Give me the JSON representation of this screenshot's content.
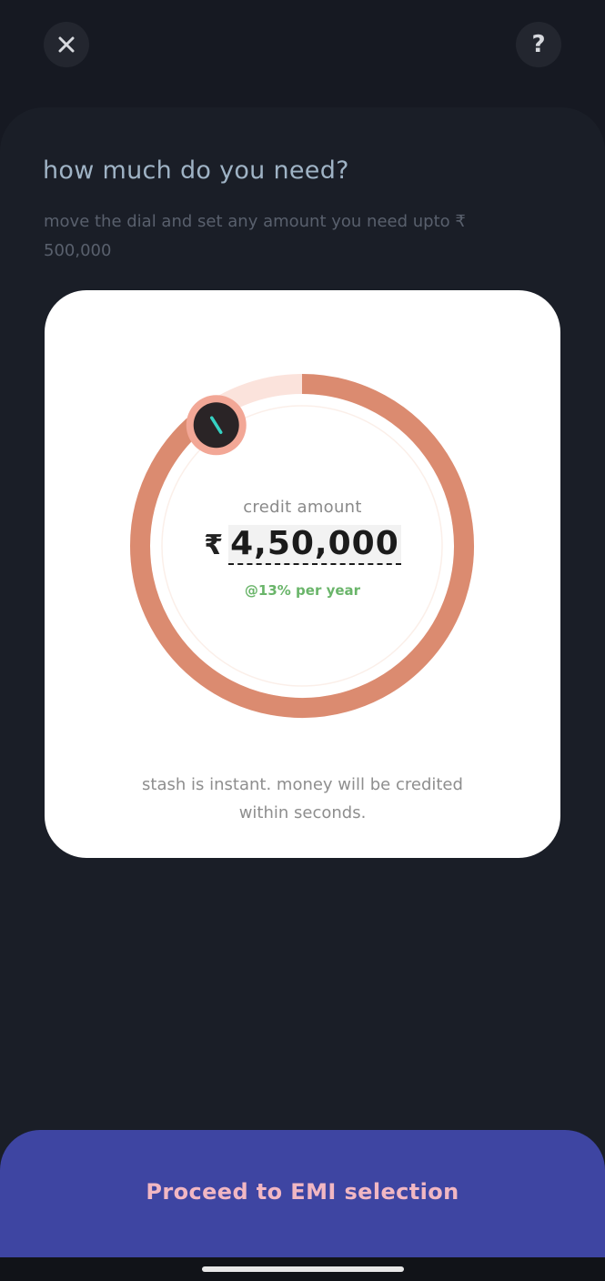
{
  "header": {
    "close_icon": "close-icon",
    "help_icon": "help-icon",
    "help_glyph": "?"
  },
  "main": {
    "title": "how much do you need?",
    "subtitle": "move the dial and set any amount you need upto ₹ 500,000"
  },
  "card": {
    "label": "credit amount",
    "currency": "₹",
    "amount": "4,50,000",
    "rate": "@13% per year",
    "note": "stash is instant. money will be credited within seconds.",
    "dial_fraction": 0.9,
    "colors": {
      "track_filled": "#db8b70",
      "track_remaining": "#fbe3dc",
      "knob": "#2a2426",
      "knob_ring": "#f2a796",
      "knob_mark": "#36d1c2"
    }
  },
  "footer": {
    "proceed_label": "Proceed to EMI selection"
  },
  "colors": {
    "background": "#161922",
    "button": "#3e45a2",
    "button_text": "#f1b7c3"
  }
}
